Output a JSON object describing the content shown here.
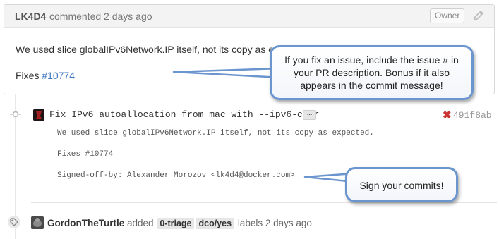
{
  "comment": {
    "author": "LK4D4",
    "action": "commented 2 days ago",
    "owner_badge": "Owner",
    "body_line1": "We used slice globalIPv6Network.IP itself, not its copy as ex",
    "fixes_label": "Fixes ",
    "issue_link": "#10774"
  },
  "commit": {
    "title": "Fix IPv6 autoallocation from mac with --ipv6-cidr",
    "ellipsis": "…",
    "status": "✖",
    "sha": "491f8ab",
    "message_lines": [
      "We used slice globalIPv6Network.IP itself, not its copy as expected.",
      "Fixes #10774",
      "Signed-off-by: Alexander Morozov <lk4d4@docker.com>"
    ]
  },
  "label_event": {
    "actor": "GordonTheTurtle",
    "verb": "added",
    "labels": [
      "0-triage",
      "dco/yes"
    ],
    "suffix": "labels 2 days ago"
  },
  "callouts": {
    "issue_tip": "If you fix an issue, include the issue # in your PR description.  Bonus if it also appears in the commit message!",
    "sign_tip": "Sign your commits!"
  },
  "colors": {
    "link": "#4078c0",
    "callout_border": "#6b95cf",
    "status_fail": "#cc3333"
  },
  "icons": [
    "pencil-icon",
    "commit-icon",
    "tag-icon",
    "x-icon"
  ]
}
